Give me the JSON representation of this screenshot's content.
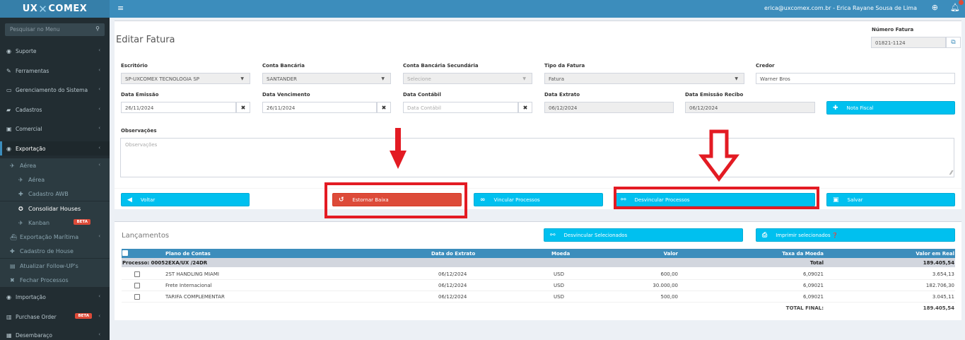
{
  "topbar": {
    "logo_left": "UX",
    "logo_x": "✕",
    "logo_right": "COMEX",
    "menu_icon": "hamburger-icon",
    "user": "erica@uxcomex.com.br - Erica Rayane Sousa de Lima"
  },
  "sidebar": {
    "search_placeholder": "Pesquisar no Menu",
    "items": [
      {
        "label": "Suporte"
      },
      {
        "label": "Ferramentas"
      },
      {
        "label": "Gerenciamento do Sistema"
      },
      {
        "label": "Cadastros"
      },
      {
        "label": "Comercial"
      },
      {
        "label": "Exportação"
      },
      {
        "label": "Aérea"
      },
      {
        "label": "Aérea"
      },
      {
        "label": "Cadastro AWB"
      },
      {
        "label": "Consolidar Houses"
      },
      {
        "label": "Kanban",
        "badge": "BETA"
      },
      {
        "label": "Exportação Marítima"
      },
      {
        "label": "Cadastro de House"
      },
      {
        "label": "Atualizar Follow-UP's"
      },
      {
        "label": "Fechar Processos"
      },
      {
        "label": "Importação"
      },
      {
        "label": "Purchase Order",
        "badge": "BETA"
      },
      {
        "label": "Desembaraço"
      }
    ]
  },
  "form": {
    "title": "Editar Fatura",
    "numero_fatura_label": "Número Fatura",
    "numero_fatura": "01821-1124",
    "escritorio_label": "Escritório",
    "escritorio": "SP-UXCOMEX TECNOLOGIA SP",
    "conta_label": "Conta Bancária",
    "conta": "SANTANDER",
    "conta_sec_label": "Conta Bancária Secundária",
    "conta_sec_ph": "Selecione",
    "tipo_label": "Tipo da Fatura",
    "tipo": "Fatura",
    "credor_label": "Credor",
    "credor": "Warner Bros",
    "emissao_label": "Data Emissão",
    "emissao": "26/11/2024",
    "vencimento_label": "Data Vencimento",
    "vencimento": "26/11/2024",
    "contabil_label": "Data Contábil",
    "contabil_ph": "Data Contábil",
    "extrato_label": "Data Extrato",
    "extrato": "06/12/2024",
    "recibo_label": "Data Emissão Recibo",
    "recibo": "06/12/2024",
    "nota_fiscal": "Nota Fiscal",
    "obs_label": "Observações",
    "obs_ph": "Observações",
    "clear_glyph": "✖"
  },
  "actions": {
    "voltar": "Voltar",
    "estornar": "Estornar Baixa",
    "vincular": "Vincular Processos",
    "desvincular": "Desvincular Processos",
    "salvar": "Salvar"
  },
  "lancamentos": {
    "title": "Lançamentos",
    "desvincular_sel": "Desvincular Selecionados",
    "imprimir_sel": "Imprimir selecionados ❓",
    "columns": [
      "Plano de Contas",
      "Data do Extrato",
      "Moeda",
      "Valor",
      "Taxa da Moeda",
      "Valor em Real"
    ],
    "group": {
      "label": "Processo: 00052EXA/UX /24DR",
      "total_label": "Total",
      "total": "189.405,54"
    },
    "rows": [
      {
        "plano": "2ST HANDLING MIAMI",
        "data": "06/12/2024",
        "moeda": "USD",
        "valor": "600,00",
        "taxa": "6,09021",
        "real": "3.654,13"
      },
      {
        "plano": "Frete Internacional",
        "data": "06/12/2024",
        "moeda": "USD",
        "valor": "30.000,00",
        "taxa": "6,09021",
        "real": "182.706,30"
      },
      {
        "plano": "TARIFA COMPLEMENTAR",
        "data": "06/12/2024",
        "moeda": "USD",
        "valor": "500,00",
        "taxa": "6,09021",
        "real": "3.045,11"
      }
    ],
    "total_final_label": "TOTAL FINAL:",
    "total_final": "189.405,54"
  },
  "colors": {
    "accent": "#3c8dbc",
    "info": "#00c0ef",
    "danger": "#dd4b39",
    "highlight": "#e31b23"
  }
}
